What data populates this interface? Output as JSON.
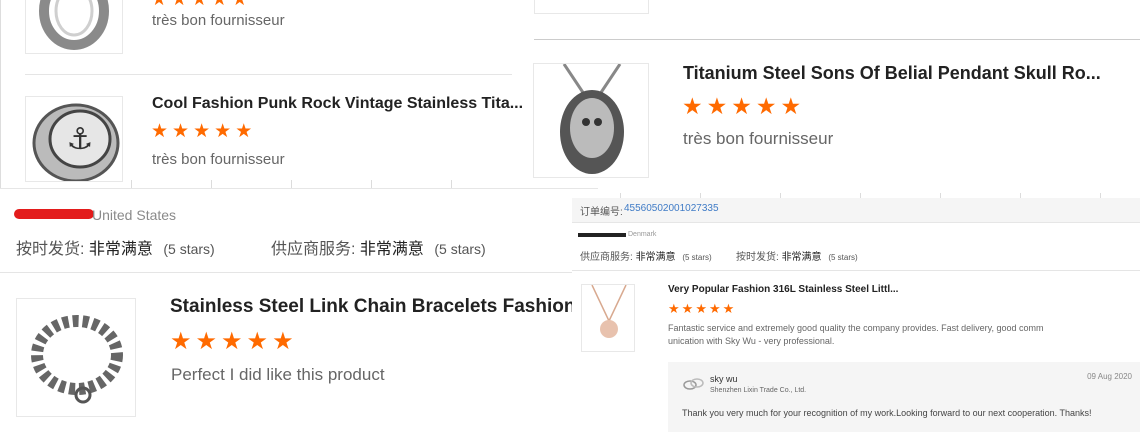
{
  "colors": {
    "star": "#ff6a00",
    "link": "#3f7bc6",
    "panel": "#f5f5f5"
  },
  "top_left": {
    "review1": {
      "comment": "très bon fournisseur",
      "stars": 5
    },
    "review2": {
      "title": "Cool Fashion Punk Rock Vintage Stainless Tita...",
      "stars": 5,
      "comment": "très bon fournisseur"
    }
  },
  "top_right": {
    "review": {
      "title": "Titanium Steel Sons Of Belial Pendant Skull Ro...",
      "stars": 5,
      "comment": "très bon fournisseur"
    }
  },
  "bottom_left": {
    "buyer_country": "United States",
    "ratings": [
      {
        "label": "按时发货:",
        "value": "非常满意",
        "stars": "(5 stars)"
      },
      {
        "label": "供应商服务:",
        "value": "非常满意",
        "stars": "(5 stars)"
      }
    ],
    "review": {
      "title": "Stainless Steel Link Chain Bracelets Fashion M...",
      "stars": 5,
      "comment": "Perfect I did like this product"
    }
  },
  "bottom_right": {
    "order_label": "订单编号:",
    "order_number": "45560502001027335",
    "buyer_country": "Denmark",
    "ratings": [
      {
        "label": "供应商服务:",
        "value": "非常满意",
        "stars": "(5 stars)"
      },
      {
        "label": "按时发货:",
        "value": "非常满意",
        "stars": "(5 stars)"
      }
    ],
    "review": {
      "title": "Very Popular Fashion 316L Stainless Steel Littl...",
      "stars": 5,
      "comment": "Fantastic service and extremely good quality the company provides. Fast delivery, good communication with Sky Wu - very professional."
    },
    "reply": {
      "name": "sky wu",
      "company": "Shenzhen Lixin Trade Co., Ltd.",
      "date": "09 Aug 2020",
      "text": "Thank you very much for your recognition of my work.Looking forward to our next cooperation. Thanks!"
    }
  }
}
